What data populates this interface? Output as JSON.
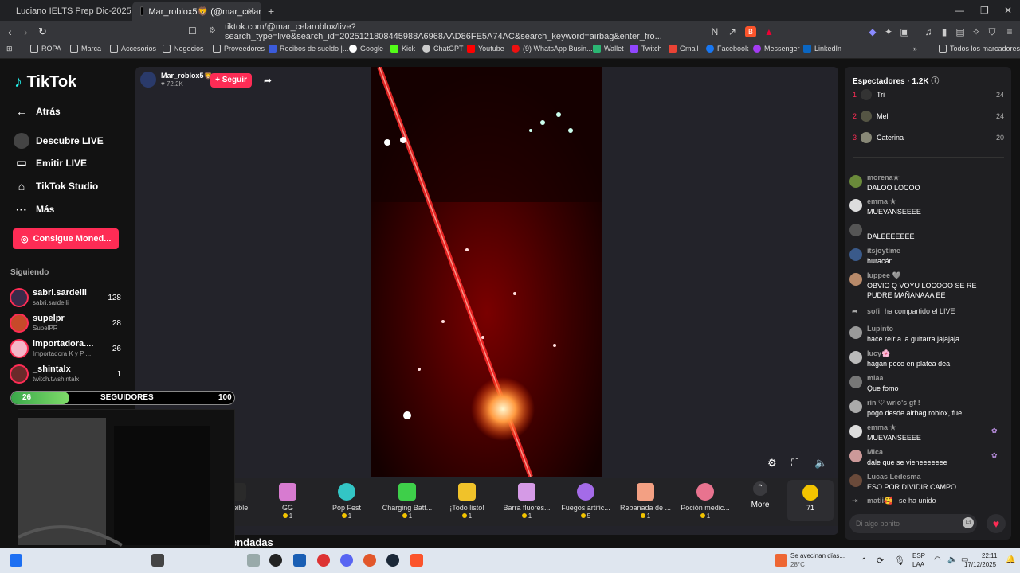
{
  "browser": {
    "tabs": [
      {
        "label": "Luciano IELTS Prep Dic-2025 - Docu"
      },
      {
        "label": "Mar_roblox5🦁 (@mar_celar"
      }
    ],
    "url": "tiktok.com/@mar_celaroblox/live?search_type=live&search_id=2025121808445988A6968AAD86FE5A74AC&search_keyword=airbag&enter_fro...",
    "bookmarks": [
      "ROPA",
      "Marca",
      "Accesorios",
      "Negocios",
      "Proveedores",
      "Recibos de sueldo |...",
      "Google",
      "Kick",
      "ChatGPT",
      "Youtube",
      "(9) WhatsApp Busin...",
      "Wallet",
      "Twitch",
      "Gmail",
      "Facebook",
      "Messenger",
      "LinkedIn"
    ],
    "all_bookmarks": "Todos los marcadores"
  },
  "sidebar": {
    "logo": "TikTok",
    "nav": [
      {
        "label": "Atrás",
        "icon": "back-arrow-icon"
      },
      {
        "label": "Descubre LIVE",
        "icon": "live-icon"
      },
      {
        "label": "Emitir LIVE",
        "icon": "camera-icon"
      },
      {
        "label": "TikTok Studio",
        "icon": "home-icon"
      },
      {
        "label": "Más",
        "icon": "more-icon"
      }
    ],
    "coins_button": "Consigue Moned...",
    "following_title": "Siguiendo",
    "following": [
      {
        "name": "sabri.sardelli",
        "sub": "sabri.sardelli",
        "count": "128"
      },
      {
        "name": "supelpr_",
        "sub": "SupelPR",
        "count": "28"
      },
      {
        "name": "importadora....",
        "sub": "Importadora K y P ...",
        "count": "26"
      },
      {
        "name": "_shintalx",
        "sub": "twitch.tv/shintalx",
        "count": "1"
      }
    ]
  },
  "goal": {
    "current": "26",
    "label": "SEGUIDORES",
    "target": "100",
    "progress": 0.26
  },
  "stream": {
    "host_name": "Mar_roblox5🦁",
    "host_likes": "72.2K",
    "follow_button": "+ Seguir",
    "more_label": "More",
    "coin_count": "71",
    "below_title": "endadas"
  },
  "gifts": [
    {
      "name": "...eible",
      "price": ""
    },
    {
      "name": "GG",
      "price": "1"
    },
    {
      "name": "Pop Fest",
      "price": "1"
    },
    {
      "name": "Charging Batt...",
      "price": "1"
    },
    {
      "name": "¡Todo listo!",
      "price": "1"
    },
    {
      "name": "Barra fluores...",
      "price": "1"
    },
    {
      "name": "Fuegos artific...",
      "price": "5"
    },
    {
      "name": "Rebanada de ...",
      "price": "1"
    },
    {
      "name": "Poción medic...",
      "price": "1"
    }
  ],
  "viewers": {
    "title": "Espectadores",
    "count": "1.2K",
    "top": [
      {
        "rank": "1",
        "name": "Tri",
        "score": "24"
      },
      {
        "rank": "2",
        "name": "Mell",
        "score": "24"
      },
      {
        "rank": "3",
        "name": "Caterina",
        "score": "20"
      }
    ]
  },
  "chat": [
    {
      "user": "morena★",
      "msg": "DALOO LOCOO"
    },
    {
      "user": "emma ★",
      "msg": "MUEVANSEEEE"
    },
    {
      "user": "",
      "msg": "DALEEEEEEE"
    },
    {
      "user": "itsjoytime",
      "msg": "huracán"
    },
    {
      "user": "luppee 🩶",
      "msg": "OBVIO Q VOYU LOCOOO SE RE PUDRE MAÑANAAA EE"
    },
    {
      "user": "sofi",
      "msg": "ha compartido el LIVE"
    },
    {
      "user": "Lupinto",
      "msg": "hace reír a la guitarra jajajaja"
    },
    {
      "user": "lucy🌸",
      "msg": "hagan poco en platea dea"
    },
    {
      "user": "miaa",
      "msg": "Que fomo"
    },
    {
      "user": "rin ♡ wrio's gf !",
      "msg": "pogo desde airbag roblox, fue"
    },
    {
      "user": "emma ★",
      "msg": "MUEVANSEEEE"
    },
    {
      "user": "Mica",
      "msg": "dale que se vieneeeeeee"
    },
    {
      "user": "Lucas Ledesma",
      "msg": "ESO POR DIVIDIR CAMPO"
    },
    {
      "user": "matii🥰",
      "msg": "se ha unido"
    }
  ],
  "chat_input_placeholder": "Di algo bonito",
  "taskbar": {
    "weather": "Se avecinan días...",
    "temp": "28°C",
    "lang1": "ESP",
    "lang2": "LAA",
    "time": "22:11",
    "date": "17/12/2025"
  }
}
